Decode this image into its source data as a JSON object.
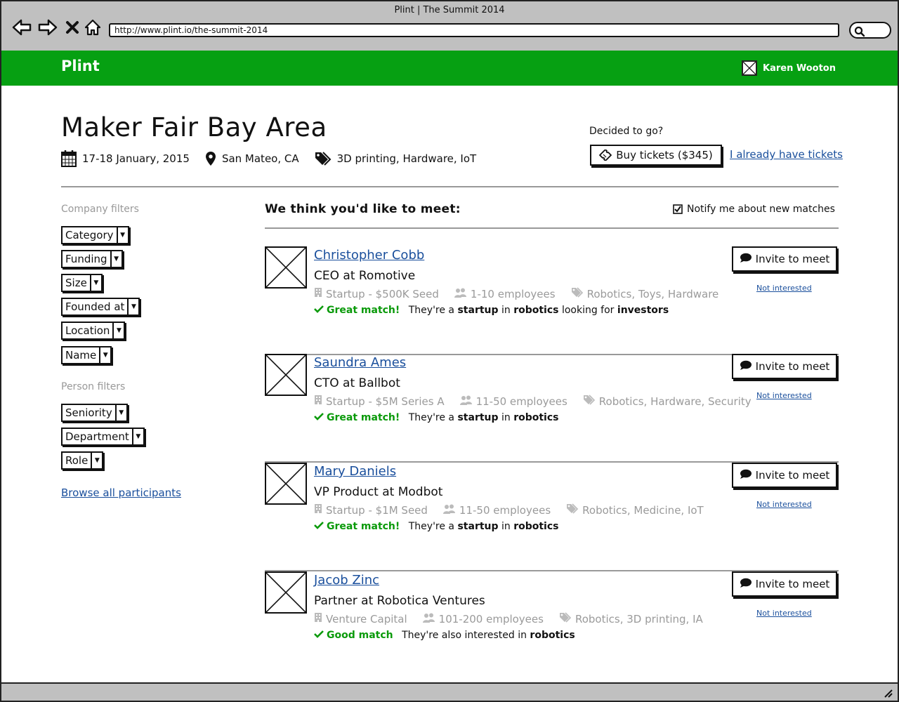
{
  "browser": {
    "window_title": "Plint | The Summit 2014",
    "url": "http://www.plint.io/the-summit-2014"
  },
  "app": {
    "brand": "Plint",
    "user_name": "Karen Wooton"
  },
  "event": {
    "title": "Maker Fair Bay Area",
    "dates": "17-18 January, 2015",
    "location": "San Mateo, CA",
    "tags": "3D printing, Hardware, IoT",
    "decided_prompt": "Decided to go?",
    "buy_label": "Buy tickets ($345)",
    "have_tickets_label": "I already have tickets"
  },
  "sidebar": {
    "company_heading": "Company filters",
    "company_filters": [
      "Category",
      "Funding",
      "Size",
      "Founded at",
      "Location",
      "Name"
    ],
    "person_heading": "Person filters",
    "person_filters": [
      "Seniority",
      "Department",
      "Role"
    ],
    "browse_label": "Browse all participants"
  },
  "matches": {
    "heading": "We think you'd like to meet:",
    "notify_label": "Notify me about new matches",
    "notify_checked": true,
    "invite_label": "Invite to meet",
    "not_interested_label": "Not interested",
    "people": [
      {
        "name": "Christopher Cobb",
        "role": "CEO at Romotive",
        "company_type": "Startup - $500K Seed",
        "employees": "1-10 employees",
        "tags": "Robotics, Toys, Hardware",
        "match_label": "Great match!",
        "match_parts": [
          "They're a ",
          "startup",
          " in ",
          "robotics",
          " looking for ",
          "investors"
        ]
      },
      {
        "name": "Saundra Ames",
        "role": "CTO at Ballbot",
        "company_type": "Startup - $5M Series A",
        "employees": "11-50 employees",
        "tags": "Robotics, Hardware, Security",
        "match_label": "Great match!",
        "match_parts": [
          "They're a ",
          "startup",
          " in ",
          "robotics"
        ]
      },
      {
        "name": "Mary Daniels",
        "role": "VP Product at Modbot",
        "company_type": "Startup - $1M Seed",
        "employees": "11-50 employees",
        "tags": "Robotics, Medicine, IoT",
        "match_label": "Great match!",
        "match_parts": [
          "They're a ",
          "startup",
          " in ",
          "robotics"
        ]
      },
      {
        "name": "Jacob Zinc",
        "role": "Partner at Robotica Ventures",
        "company_type": "Venture Capital",
        "employees": "101-200 employees",
        "tags": "Robotics, 3D printing, IA",
        "match_label": "Good match",
        "match_parts": [
          "They're also interested in ",
          "robotics"
        ]
      }
    ]
  },
  "colors": {
    "brand_green": "#06a012",
    "link_blue": "#1a4f9c",
    "match_green": "#0a9a0a",
    "muted_gray": "#9a9a9a"
  }
}
